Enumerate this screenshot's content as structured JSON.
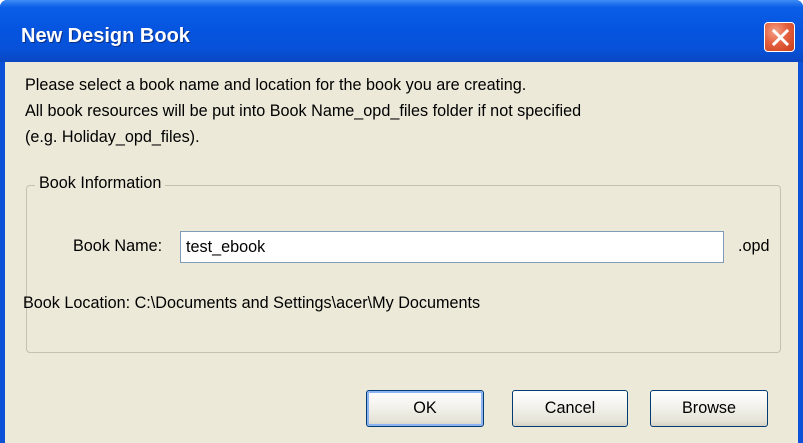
{
  "window": {
    "title": "New Design Book",
    "close_icon": "close-icon"
  },
  "description": {
    "line1": "Please select a book name and location for the book you are creating.",
    "line2": "All book resources will be put into Book Name_opd_files folder if not specified",
    "line3": "(e.g. Holiday_opd_files)."
  },
  "group": {
    "legend": "Book Information",
    "name_label": "Book Name:",
    "name_value": "test_ebook",
    "extension": ".opd",
    "location_label": "Book Location:",
    "location_value": "C:\\Documents and Settings\\acer\\My Documents"
  },
  "buttons": {
    "ok": "OK",
    "cancel": "Cancel",
    "browse": "Browse"
  },
  "colors": {
    "titlebar": "#0555e0",
    "client_bg": "#ece9d8",
    "close_button": "#e4613f"
  }
}
